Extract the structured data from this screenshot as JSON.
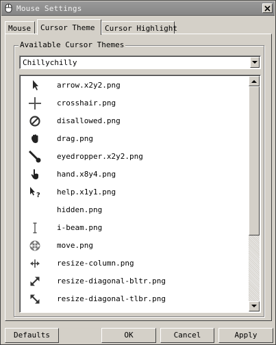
{
  "window": {
    "title": "Mouse Settings"
  },
  "tabs": [
    {
      "label": "Mouse"
    },
    {
      "label": "Cursor Theme"
    },
    {
      "label": "Cursor Highlight"
    }
  ],
  "active_tab": "Cursor Theme",
  "group": {
    "title": "Available Cursor Themes",
    "selected_theme": "Chillychilly"
  },
  "cursors": [
    {
      "label": "arrow.x2y2.png",
      "icon": "arrow-cursor-icon"
    },
    {
      "label": "crosshair.png",
      "icon": "crosshair-icon"
    },
    {
      "label": "disallowed.png",
      "icon": "disallowed-icon"
    },
    {
      "label": "drag.png",
      "icon": "drag-hand-icon"
    },
    {
      "label": "eyedropper.x2y2.png",
      "icon": "eyedropper-icon"
    },
    {
      "label": "hand.x8y4.png",
      "icon": "pointing-hand-icon"
    },
    {
      "label": "help.x1y1.png",
      "icon": "help-cursor-icon"
    },
    {
      "label": "hidden.png",
      "icon": ""
    },
    {
      "label": "i-beam.png",
      "icon": "i-beam-icon"
    },
    {
      "label": "move.png",
      "icon": "move-icon"
    },
    {
      "label": "resize-column.png",
      "icon": "resize-column-icon"
    },
    {
      "label": "resize-diagonal-bltr.png",
      "icon": "resize-diagonal-bltr-icon"
    },
    {
      "label": "resize-diagonal-tlbr.png",
      "icon": "resize-diagonal-tlbr-icon"
    }
  ],
  "buttons": {
    "defaults": "Defaults",
    "ok": "OK",
    "cancel": "Cancel",
    "apply": "Apply"
  },
  "colors": {
    "face": "#d4d0c8",
    "titlebar": "#8e8e8e",
    "title_text": "#f0f0f0"
  }
}
